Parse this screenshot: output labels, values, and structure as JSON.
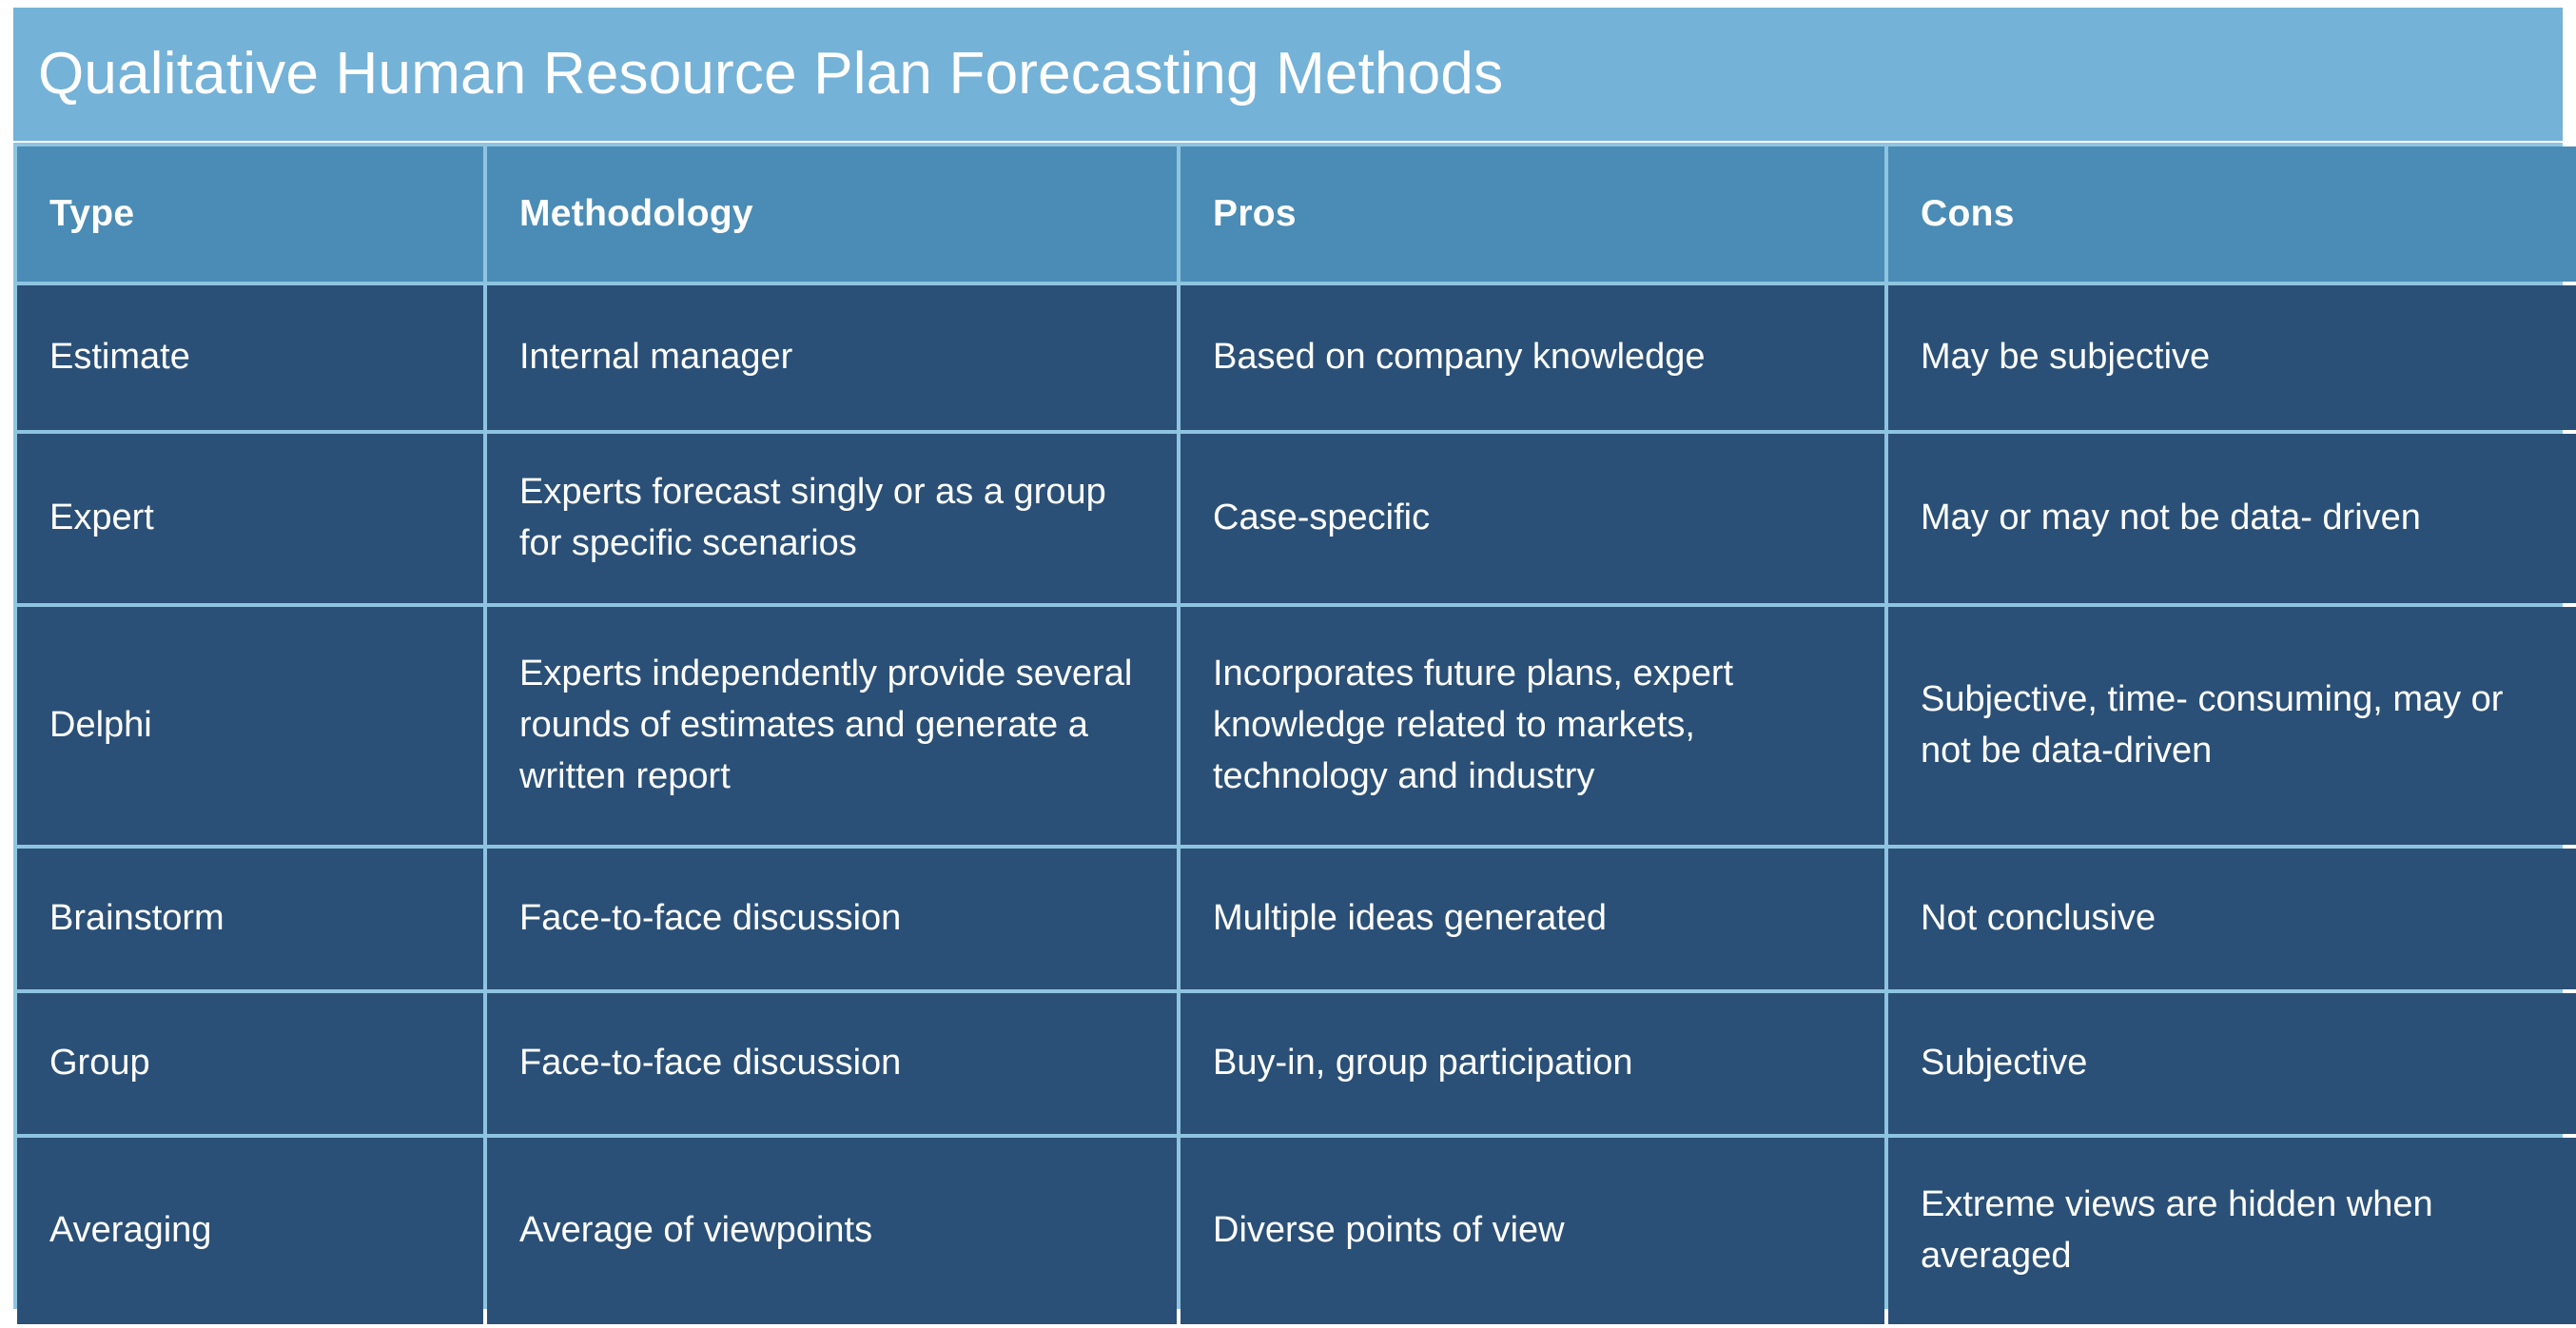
{
  "slide": {
    "title": "Qualitative Human Resource Plan Forecasting Methods",
    "colors": {
      "title_background": "#74b2d8",
      "header_background": "#4a8cb5",
      "cell_background": "#2b5077",
      "grid_line": "#8fc4e0",
      "text": "#ffffff"
    }
  },
  "table": {
    "columns": [
      {
        "key": "type",
        "label": "Type"
      },
      {
        "key": "methodology",
        "label": "Methodology"
      },
      {
        "key": "pros",
        "label": "Pros"
      },
      {
        "key": "cons",
        "label": "Cons"
      }
    ],
    "rows": [
      {
        "type": "Estimate",
        "methodology": "Internal manager",
        "pros": "Based on company knowledge",
        "cons": "May be subjective"
      },
      {
        "type": "Expert",
        "methodology": "Experts forecast singly or as a group for specific scenarios",
        "pros": "Case-specific",
        "cons": "May or may not be data- driven"
      },
      {
        "type": "Delphi",
        "methodology": "Experts independently provide several rounds of estimates and generate a written report",
        "pros": "Incorporates future plans, expert knowledge related to markets, technology and industry",
        "cons": "Subjective, time- consuming, may or not be data-driven"
      },
      {
        "type": "Brainstorm",
        "methodology": "Face-to-face discussion",
        "pros": "Multiple ideas generated",
        "cons": "Not conclusive"
      },
      {
        "type": "Group",
        "methodology": "Face-to-face discussion",
        "pros": "Buy-in, group participation",
        "cons": "Subjective"
      },
      {
        "type": "Averaging",
        "methodology": "Average of viewpoints",
        "pros": "Diverse points of view",
        "cons": "Extreme views are hidden when averaged"
      }
    ]
  }
}
